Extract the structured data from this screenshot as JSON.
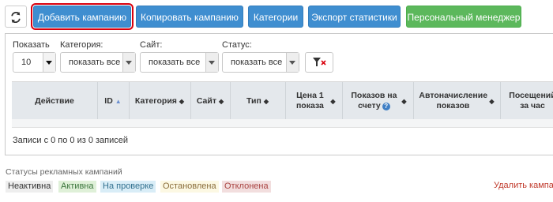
{
  "toolbar": {
    "refresh_icon": "refresh-icon",
    "buttons": [
      "Добавить кампанию",
      "Копировать кампанию",
      "Категории",
      "Экспорт статистики",
      "Персональный менеджер"
    ]
  },
  "filters": {
    "show_label": "Показать",
    "show_value": "10",
    "category_label": "Категория:",
    "category_value": "показать все",
    "site_label": "Сайт:",
    "site_value": "показать все",
    "status_label": "Статус:",
    "status_value": "показать все",
    "clear_icon": "filter-clear-icon"
  },
  "table": {
    "columns": [
      "Действие",
      "ID",
      "Категория",
      "Сайт",
      "Тип",
      "Цена 1 показа",
      "Показов на счету",
      "Автоначисление показов",
      "Посещений за час"
    ]
  },
  "records_text": "Записи с 0 по 0 из 0 записей",
  "statuses": {
    "title": "Статусы рекламных кампаний",
    "items": [
      {
        "label": "Неактивна",
        "bg": "#eeeeee",
        "color": "#333333"
      },
      {
        "label": "Активна",
        "bg": "#dff0d8",
        "color": "#3c763d"
      },
      {
        "label": "На проверке",
        "bg": "#d9edf7",
        "color": "#31708f"
      },
      {
        "label": "Остановлена",
        "bg": "#fcf8e3",
        "color": "#8a6d3b"
      },
      {
        "label": "Отклонена",
        "bg": "#f2dede",
        "color": "#a94442"
      }
    ]
  },
  "delete_text": "Удалить кампа"
}
